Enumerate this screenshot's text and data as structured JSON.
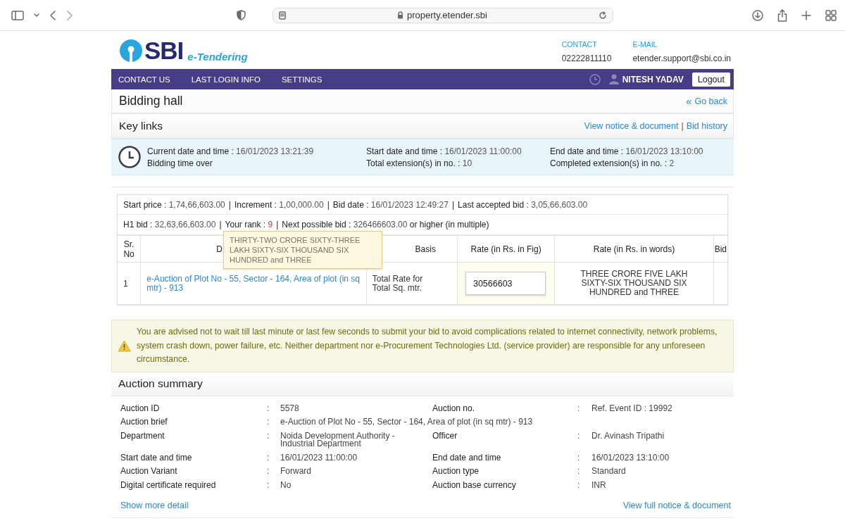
{
  "browser": {
    "url": "property.etender.sbi"
  },
  "logo": {
    "name": "SBI",
    "tagline": "e-Tendering"
  },
  "contacts": [
    {
      "label": "CONTACT",
      "value": "02222811110"
    },
    {
      "label": "E-MAIL",
      "value": "etender.support@sbi.co.in"
    }
  ],
  "nav": {
    "items": [
      "CONTACT US",
      "LAST LOGIN INFO",
      "SETTINGS"
    ],
    "user": "NITESH YADAV",
    "logout": "Logout"
  },
  "page": {
    "title": "Bidding hall",
    "back_icon": "«",
    "back": "Go back"
  },
  "key_links": {
    "title": "Key links",
    "separator": "|",
    "links": [
      "View notice & document",
      "Bid history"
    ]
  },
  "timing": [
    [
      {
        "label": "Current date and time :",
        "value": "16/01/2023 13:21:39"
      },
      {
        "label": "Bidding time over"
      }
    ],
    [
      {
        "label": "Start date and time :",
        "value": "16/01/2023 11:00:00"
      },
      {
        "label": "Total extension(s) in no. :",
        "value": "10"
      }
    ],
    [
      {
        "label": "End date and time :",
        "value": "16/01/2023 13:10:00"
      },
      {
        "label": "Completed extension(s) in no. :",
        "value": "2"
      }
    ]
  ],
  "bid_info": {
    "separator": "|",
    "lines": [
      [
        {
          "label": "Start price  :",
          "value": "1,74,66,603.00",
          "highlight": false
        },
        {
          "label": "Increment :",
          "value": "1,00,000.00",
          "highlight": false
        },
        {
          "label": "Bid date :",
          "value": "16/01/2023 12:49:27",
          "highlight": false
        },
        {
          "label": "Last accepted bid :",
          "value": "3,05,66,603.00",
          "highlight": false
        }
      ],
      [
        {
          "label": "H1 bid :",
          "value": "32,63,66,603.00",
          "highlight": false
        },
        {
          "label": "Your rank :",
          "value": "9",
          "highlight": true
        },
        {
          "label": "Next possible bid :",
          "value": "326466603.00",
          "suffix": "or higher (in multiple)",
          "highlight": false
        }
      ]
    ]
  },
  "table": {
    "columns": [
      "Sr. No",
      "D",
      "Basis",
      "Rate (in Rs. in Fig)",
      "Rate (in Rs. in words)",
      "Bid"
    ],
    "rows": [
      {
        "sr_no": "1",
        "description": "e-Auction of Plot No - 55, Sector - 164, Area of plot (in sq mtr) - 913",
        "basis": "Total Rate for Total Sq. mtr.",
        "rate_fig": "30566603",
        "rate_words": "THREE CRORE FIVE LAKH SIXTY-SIX THOUSAND SIX HUNDRED and THREE"
      }
    ]
  },
  "tooltip": "THIRTY-TWO CRORE SIXTY-THREE LAKH SIXTY-SIX THOUSAND SIX HUNDRED and THREE",
  "warning": "You are advised not to wait till last minute or last few seconds to submit your bid to avoid complications related to internet connectivity, network problems, system crash down, power failure, etc. Neither department nor e-Procurement Technologies Ltd. (service provider) are responsible for any unforeseen circumstance.",
  "summary": {
    "title": "Auction summary",
    "separator": ":",
    "rows": [
      [
        {
          "label": "Auction ID",
          "value": "5578"
        },
        {
          "label": "Auction no.",
          "value": "Ref. Event ID : 19992"
        }
      ],
      [
        {
          "label": "Auction brief",
          "value": "e-Auction of Plot No - 55, Sector - 164, Area of plot (in sq mtr) - 913"
        }
      ],
      [
        {
          "label": "Department",
          "value": "Noida Development Authority - Industrial Department"
        },
        {
          "label": "Officer",
          "value": "Dr. Avinash Tripathi"
        }
      ],
      [
        {
          "label": "Start date and time",
          "value": "16/01/2023 11:00:00"
        },
        {
          "label": "End date and time",
          "value": "16/01/2023 13:10:00"
        }
      ],
      [
        {
          "label": "Auction Variant",
          "value": "Forward"
        },
        {
          "label": "Auction type",
          "value": "Standard"
        }
      ],
      [
        {
          "label": "Digital certificate required",
          "value": "No"
        },
        {
          "label": "Auction base currency",
          "value": "INR"
        }
      ]
    ],
    "links": [
      "Show more detail",
      "View full notice & document"
    ]
  }
}
